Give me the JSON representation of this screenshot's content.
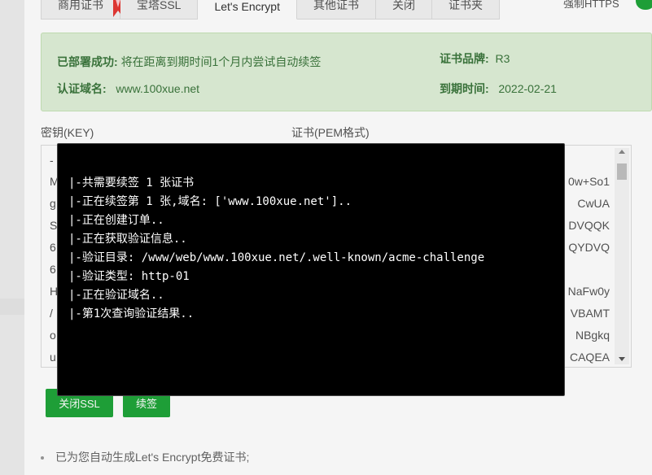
{
  "tabs": [
    {
      "label": "商用证书"
    },
    {
      "label": "宝塔SSL"
    },
    {
      "label": "Let's Encrypt"
    },
    {
      "label": "其他证书"
    },
    {
      "label": "关闭"
    },
    {
      "label": "证书夹"
    }
  ],
  "force_https_label": "强制HTTPS",
  "info": {
    "deploy_label": "已部署成功:",
    "deploy_text": "将在距离到期时间1个月内尝试自动续签",
    "domain_label": "认证域名:",
    "domain_value": "www.100xue.net",
    "brand_label": "证书品牌:",
    "brand_value": "R3",
    "expire_label": "到期时间:",
    "expire_value": "2022-02-21"
  },
  "key_title": "密钥(KEY)",
  "cert_title": "证书(PEM格式)",
  "key_partial": [
    "-",
    "M",
    "g",
    "S",
    "6",
    "6",
    "H",
    "/",
    "o",
    "u"
  ],
  "cert_partial": [
    "0w+So1",
    "CwUA",
    "DVQQK",
    "QYDVQ",
    "",
    "NaFw0y",
    "VBAMT",
    "NBgkq",
    "CAQEA"
  ],
  "buttons": {
    "close_ssl": "关闭SSL",
    "renew": "续签"
  },
  "note": "已为您自动生成Let's Encrypt免费证书;",
  "terminal": {
    "lines": [
      "|-共需要续签 1 张证书",
      "|-正在续签第 1 张,域名: ['www.100xue.net']..",
      "|-正在创建订单..",
      "|-正在获取验证信息..",
      "|-验证目录: /www/web/www.100xue.net/.well-known/acme-challenge",
      "|-验证类型: http-01",
      "|-正在验证域名..",
      "|-第1次查询验证结果.."
    ]
  },
  "colors": {
    "accent": "#20a53a",
    "alert_bg": "#dff0d8",
    "alert_text": "#3c763d",
    "terminal_bg": "#000000"
  }
}
